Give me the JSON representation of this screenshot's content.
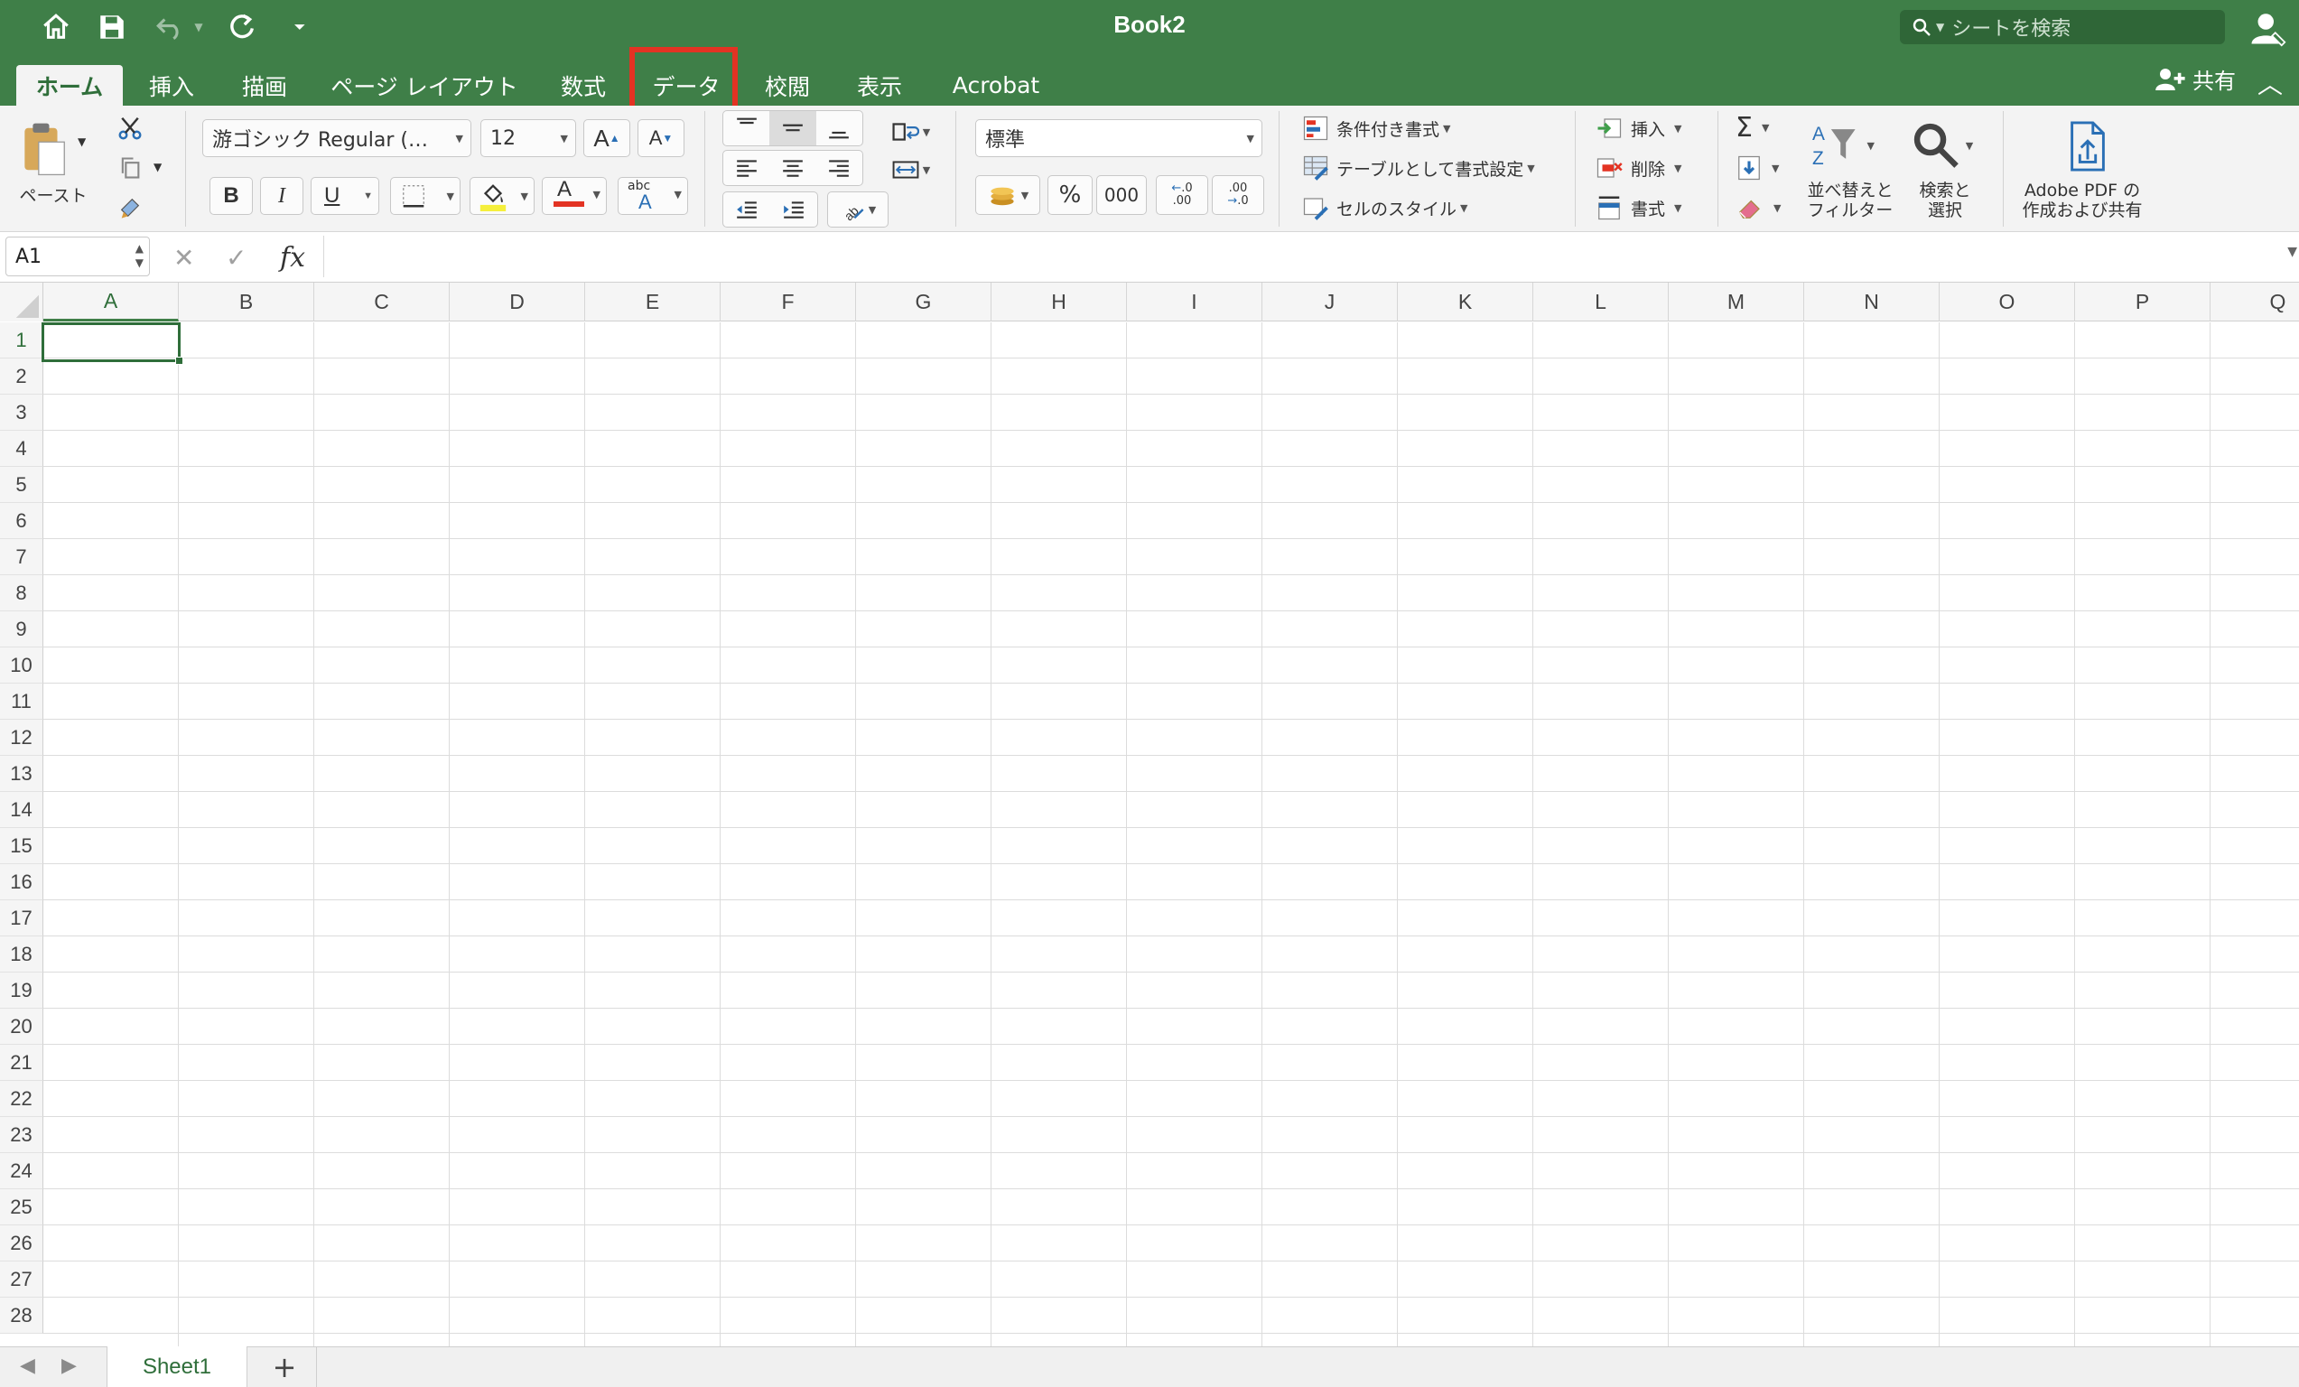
{
  "window": {
    "title": "Book2"
  },
  "search": {
    "placeholder": "シートを検索"
  },
  "tabs": [
    {
      "label": "ホーム",
      "active": true
    },
    {
      "label": "挿入"
    },
    {
      "label": "描画"
    },
    {
      "label": "ページ レイアウト"
    },
    {
      "label": "数式"
    },
    {
      "label": "データ",
      "highlighted": true
    },
    {
      "label": "校閲"
    },
    {
      "label": "表示"
    },
    {
      "label": "Acrobat"
    }
  ],
  "share_label": "共有",
  "ribbon": {
    "paste_label": "ペースト",
    "font_name": "游ゴシック Regular (…",
    "font_size": "12",
    "bold": "B",
    "italic": "I",
    "underline": "U",
    "font_color_glyph": "A",
    "phonetic_top": "abc",
    "phonetic_bottom": "A",
    "number_format": "標準",
    "percent": "%",
    "comma": "000",
    "conditional_format": "条件付き書式",
    "format_as_table": "テーブルとして書式設定",
    "cell_styles": "セルのスタイル",
    "insert": "挿入",
    "delete": "削除",
    "format": "書式",
    "sort_filter_line1": "並べ替えと",
    "sort_filter_line2": "フィルター",
    "find_select_line1": "検索と",
    "find_select_line2": "選択",
    "adobe_line1": "Adobe PDF の",
    "adobe_line2": "作成および共有"
  },
  "formula_bar": {
    "name_box": "A1",
    "fx": "fx",
    "value": ""
  },
  "columns": [
    "A",
    "B",
    "C",
    "D",
    "E",
    "F",
    "G",
    "H",
    "I",
    "J",
    "K",
    "L",
    "M",
    "N",
    "O",
    "P",
    "Q"
  ],
  "rows": [
    "1",
    "2",
    "3",
    "4",
    "5",
    "6",
    "7",
    "8",
    "9",
    "10",
    "11",
    "12",
    "13",
    "14",
    "15",
    "16",
    "17",
    "18",
    "19",
    "20",
    "21",
    "22",
    "23",
    "24",
    "25",
    "26",
    "27",
    "28"
  ],
  "active_cell": "A1",
  "sheets": [
    {
      "name": "Sheet1",
      "active": true
    }
  ],
  "add_sheet": "+",
  "colors": {
    "accent": "#3f7f48",
    "highlight": "#e33323"
  }
}
